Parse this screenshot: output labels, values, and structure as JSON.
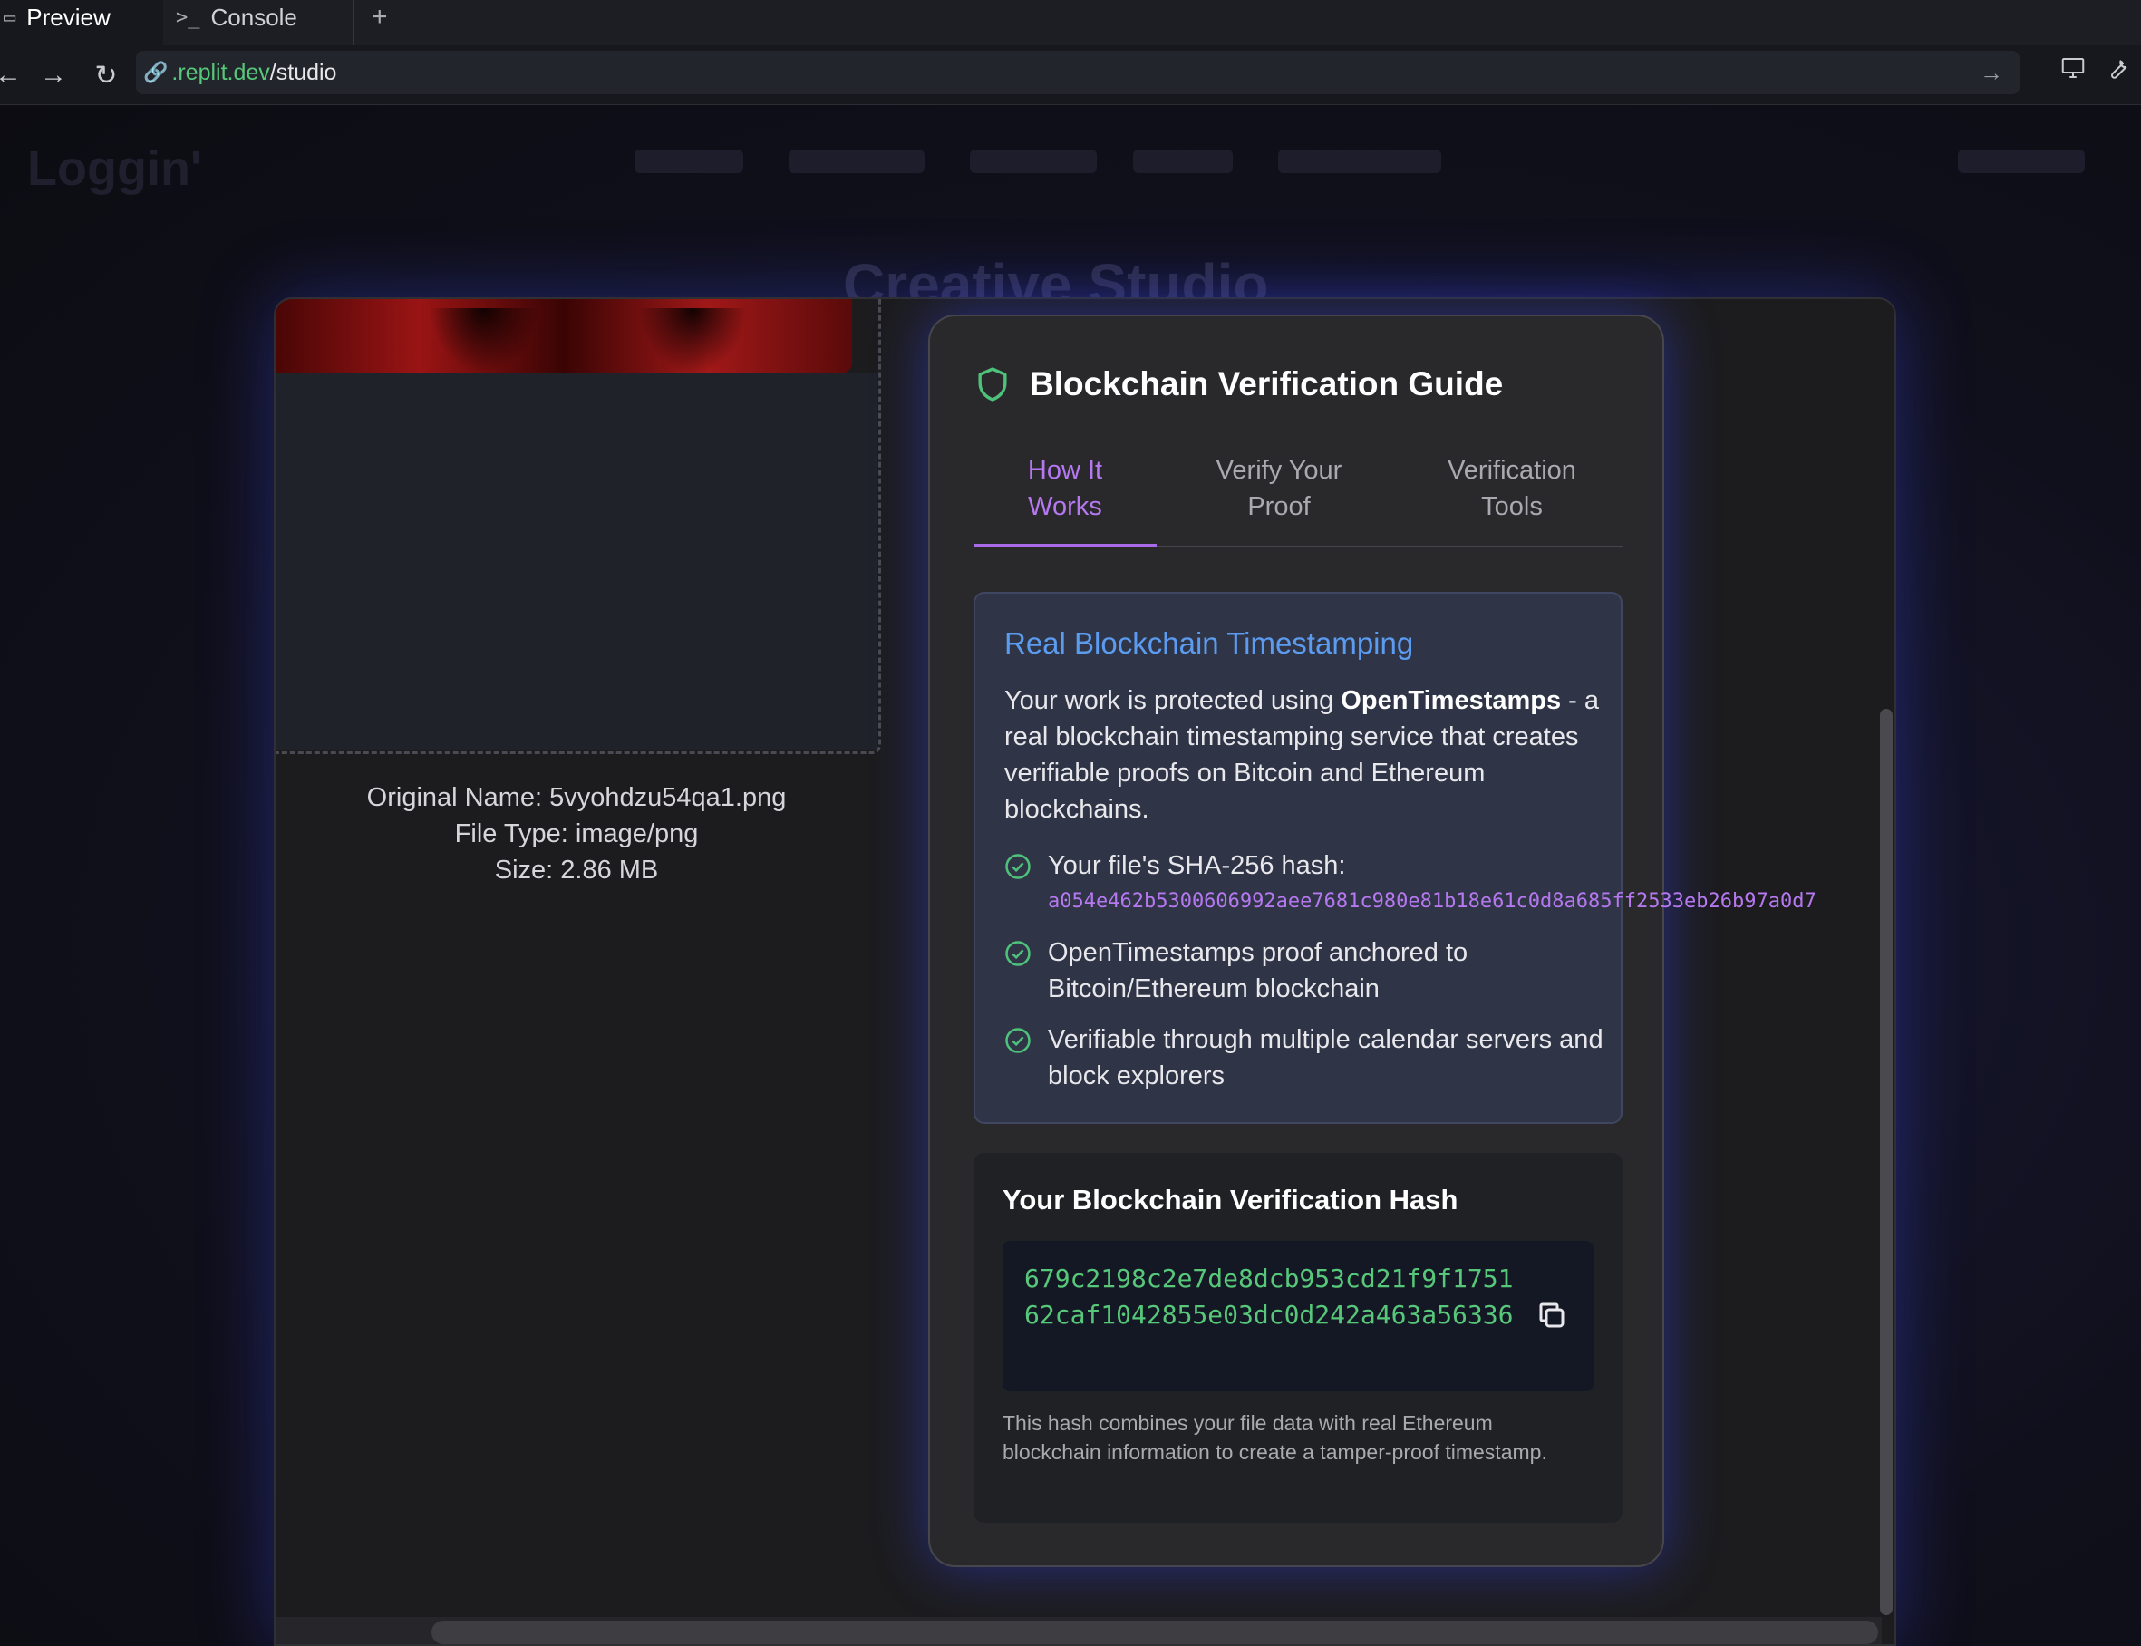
{
  "browser": {
    "tabs": [
      {
        "label": "Preview",
        "icon": "window-icon",
        "active": true
      },
      {
        "label": "Console",
        "icon": "terminal-icon",
        "active": false
      }
    ],
    "new_tab": "+",
    "url_domain": ".replit.dev",
    "url_path": "/studio"
  },
  "background": {
    "logo": "Loggin'",
    "page_title": "Creative Studio"
  },
  "file_info": {
    "original_name": "Original Name: 5vyohdzu54qa1.png",
    "file_type": "File Type: image/png",
    "size": "Size: 2.86 MB"
  },
  "guide": {
    "title": "Blockchain Verification Guide",
    "tabs": [
      {
        "line1": "How It",
        "line2": "Works",
        "active": true
      },
      {
        "line1": "Verify Your",
        "line2": "Proof",
        "active": false
      },
      {
        "line1": "Verification",
        "line2": "Tools",
        "active": false
      }
    ],
    "info": {
      "heading": "Real Blockchain Timestamping",
      "intro_before": "Your work is protected using ",
      "intro_bold": "OpenTimestamps",
      "intro_after": " - a real blockchain timestamping service that creates verifiable proofs on Bitcoin and Ethereum blockchains.",
      "items": [
        {
          "text": "Your file's SHA-256 hash:",
          "hash": "a054e462b5300606992aee7681c980e81b18e61c0d8a685ff2533eb26b97a0d7"
        },
        {
          "text": "OpenTimestamps proof anchored to Bitcoin/Ethereum blockchain"
        },
        {
          "text": "Verifiable through multiple calendar servers and block explorers"
        }
      ]
    },
    "hash_card": {
      "title": "Your Blockchain Verification Hash",
      "hash": "679c2198c2e7de8dcb953cd21f9f175162caf1042855e03dc0d242a463a56336",
      "note": "This hash combines your file data with real Ethereum blockchain information to create a tamper-proof timestamp."
    }
  },
  "colors": {
    "accent_purple": "#b678f0",
    "heading_blue": "#5b9cf0",
    "hash_green": "#57c87a",
    "check_green": "#4ec27a"
  }
}
